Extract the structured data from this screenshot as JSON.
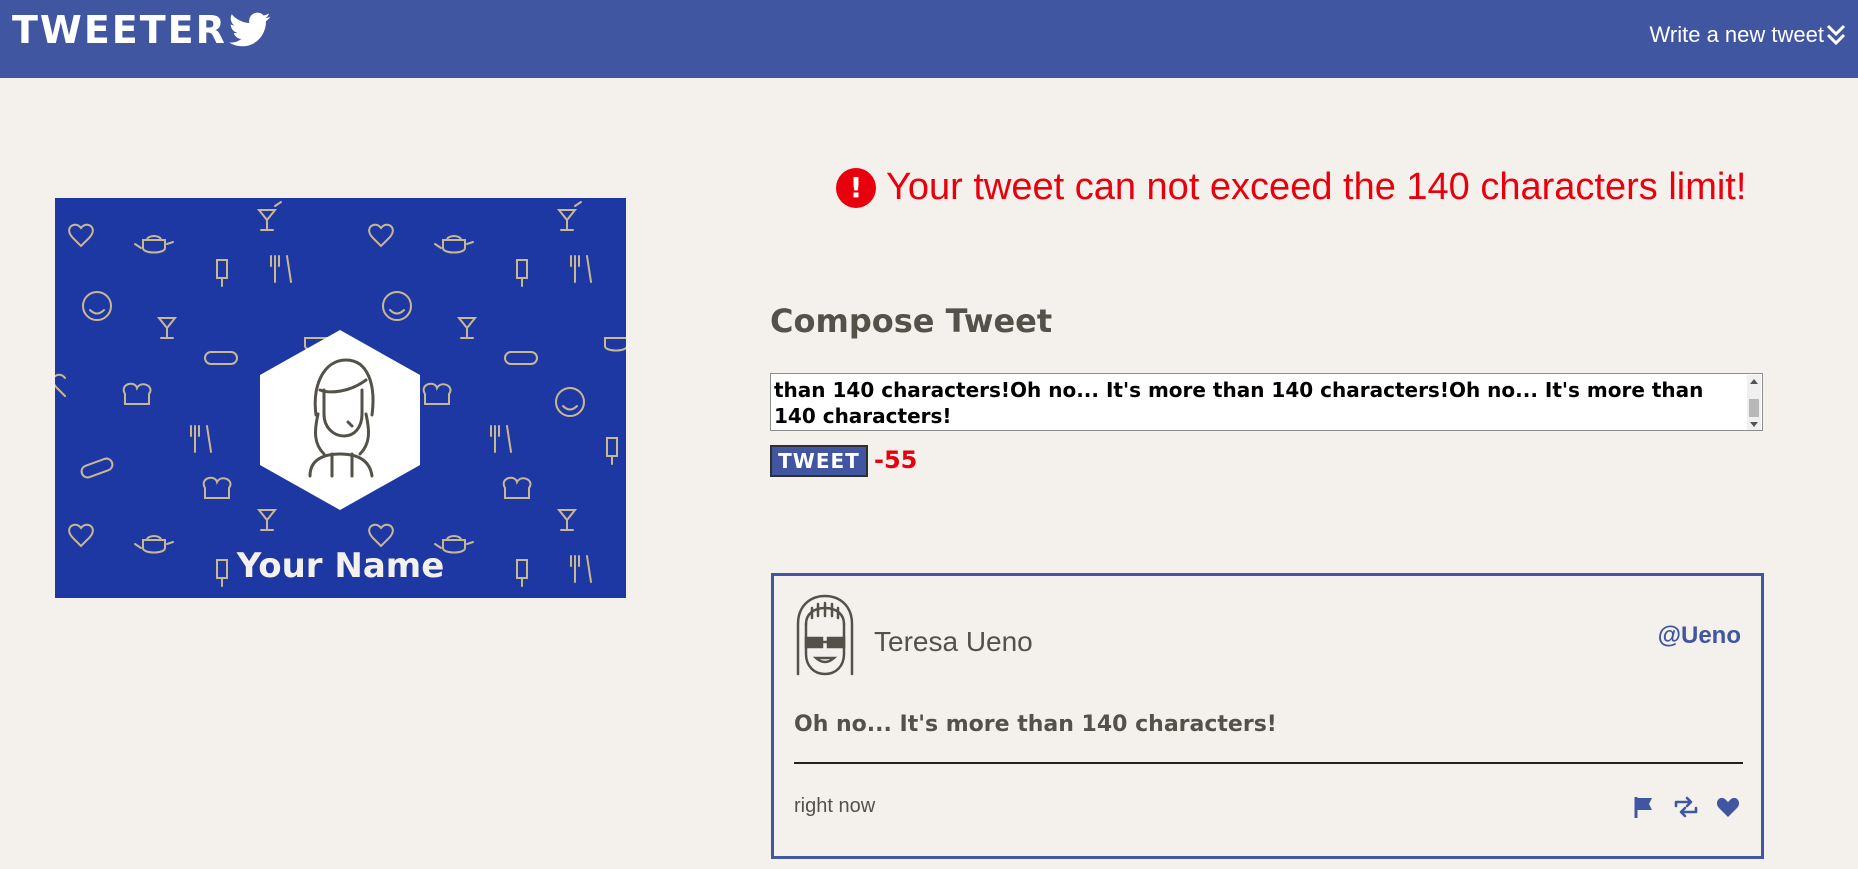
{
  "nav": {
    "brand": "TWEETER",
    "write_link": "Write a new tweet"
  },
  "profile": {
    "name": "Your Name"
  },
  "error": {
    "icon": "!",
    "message": "Your tweet can not exceed the 140 characters limit!"
  },
  "compose": {
    "title": "Compose Tweet",
    "textarea_value": "than 140 characters!Oh no... It's more than 140 characters!Oh no... It's more than 140 characters!",
    "button_label": "TWEET",
    "counter": "-55"
  },
  "tweet": {
    "author": "Teresa Ueno",
    "handle": "@Ueno",
    "body": "Oh no... It's more than 140 characters!",
    "time": "right now"
  },
  "colors": {
    "nav": "#4056a1",
    "background": "#f4f1ec",
    "error": "#e8000d",
    "profile_bg": "#1e38a3"
  },
  "icons": [
    "twitter-bird-icon",
    "double-chevron-down-icon",
    "error-icon",
    "flag-icon",
    "retweet-icon",
    "heart-icon"
  ]
}
